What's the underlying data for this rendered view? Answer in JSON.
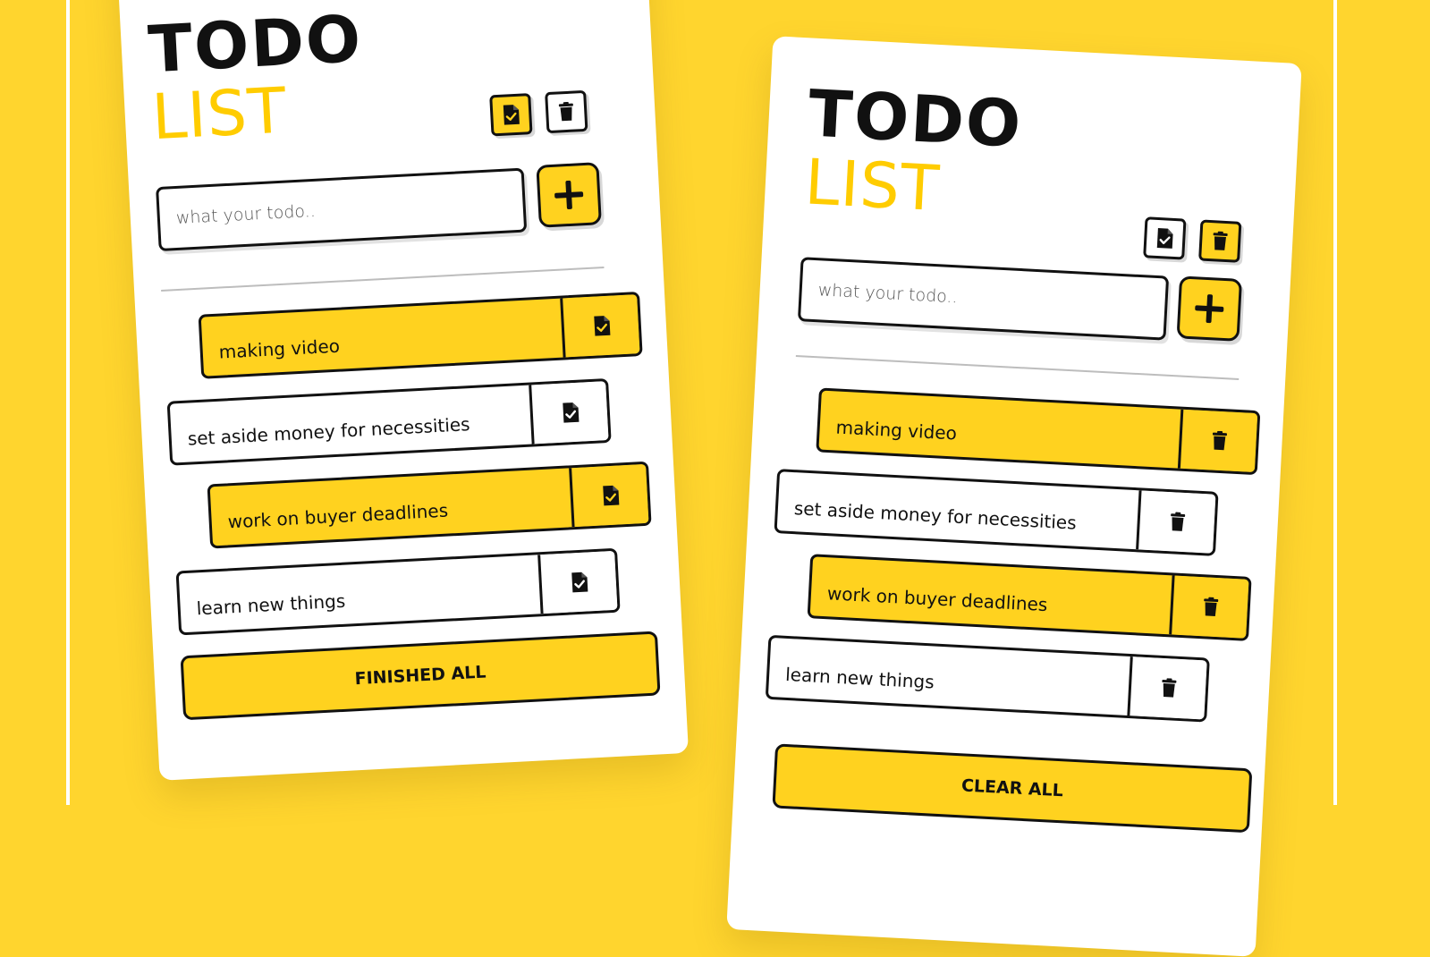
{
  "colors": {
    "background": "#FFD52E",
    "accent": "#FFD21F",
    "card": "#FFFFFF",
    "ink": "#111111"
  },
  "left_card": {
    "title_line1": "TODO",
    "title_line2": "LIST",
    "toolbar": [
      {
        "icon": "file-check-icon",
        "active": true
      },
      {
        "icon": "trash-icon",
        "active": false
      }
    ],
    "input_placeholder": "what your todo..",
    "add_icon": "plus-icon",
    "tasks": [
      {
        "text": "making video",
        "style": "yellow",
        "action_icon": "file-check-icon"
      },
      {
        "text": "set aside money for necessities",
        "style": "white",
        "action_icon": "file-check-icon"
      },
      {
        "text": "work on buyer deadlines",
        "style": "yellow",
        "action_icon": "file-check-icon"
      },
      {
        "text": "learn new things",
        "style": "white",
        "action_icon": "file-check-icon"
      }
    ],
    "bottom_button": "FINISHED ALL"
  },
  "right_card": {
    "title_line1": "TODO",
    "title_line2": "LIST",
    "toolbar": [
      {
        "icon": "file-check-icon",
        "active": false
      },
      {
        "icon": "trash-icon",
        "active": true
      }
    ],
    "input_placeholder": "what your todo..",
    "add_icon": "plus-icon",
    "tasks": [
      {
        "text": "making video",
        "style": "yellow",
        "action_icon": "trash-icon"
      },
      {
        "text": "set aside money for necessities",
        "style": "white",
        "action_icon": "trash-icon"
      },
      {
        "text": "work on buyer deadlines",
        "style": "yellow",
        "action_icon": "trash-icon"
      },
      {
        "text": "learn new things",
        "style": "white",
        "action_icon": "trash-icon"
      }
    ],
    "bottom_button": "CLEAR ALL"
  }
}
